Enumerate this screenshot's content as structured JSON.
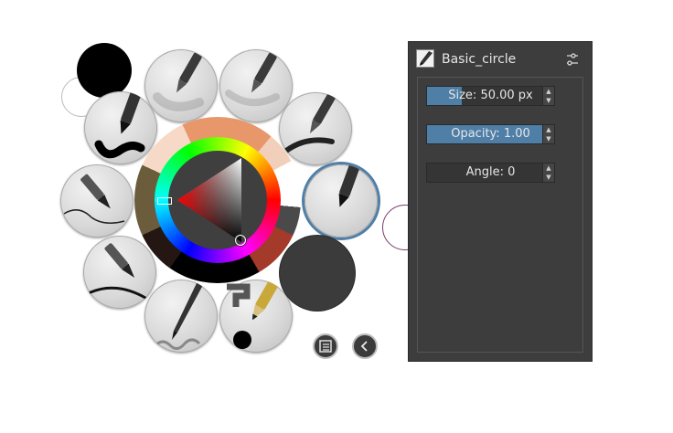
{
  "panel": {
    "preset_name": "Basic_circle",
    "size_label": "Size:",
    "size_value": "50.00 px",
    "size_fraction": 0.3,
    "opacity_label": "Opacity:",
    "opacity_value": "1.00",
    "opacity_fraction": 1.0,
    "angle_label": "Angle:",
    "angle_value": "0",
    "angle_fraction": 0.0
  },
  "colors": {
    "foreground": "#000000",
    "background": "#ffffff",
    "accent": "#4f7fa7",
    "panel_bg": "#3d3d3d"
  },
  "icons": {
    "preset_icon": "brush-preset-icon",
    "settings_icon": "sliders-icon",
    "docker_icon": "list-icon",
    "back_icon": "chevron-left-icon"
  }
}
